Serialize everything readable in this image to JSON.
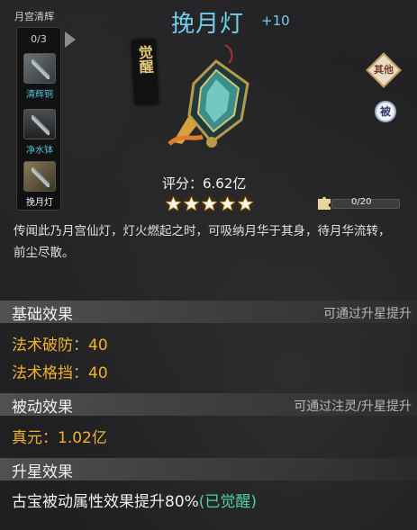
{
  "set": {
    "title": "月宫清辉",
    "count": "0/3",
    "items": [
      {
        "label": "清辉铜"
      },
      {
        "label": "净水钵"
      },
      {
        "label": "挽月灯"
      }
    ]
  },
  "item": {
    "name": "挽月灯",
    "level": "+10",
    "awaken_badge": "觉醒",
    "score": "评分：6.62亿",
    "stars": 5,
    "fragments_text": "0/20",
    "fragments_progress": 0.0,
    "description": "传闻此乃月宫仙灯，灯火燃起之时，可吸纳月华于其身，待月华流转，前尘尽散。"
  },
  "tags": {
    "other": "其他",
    "passive": "被"
  },
  "sections": {
    "basic": {
      "title": "基础效果",
      "hint": "可通过升星提升",
      "stats": [
        "法术破防：40",
        "法术格挡：40"
      ]
    },
    "passive": {
      "title": "被动效果",
      "hint": "可通过注灵/升星提升",
      "stats": [
        "真元：1.02亿"
      ]
    },
    "starup": {
      "title": "升星效果",
      "text": "古宝被动属性效果提升80%",
      "status": "(已觉醒)"
    }
  },
  "colors": {
    "title": "#6fd0ee",
    "stat": "#f0b22c",
    "awakened": "#4fd1a0",
    "set_link": "#55c2d6"
  }
}
